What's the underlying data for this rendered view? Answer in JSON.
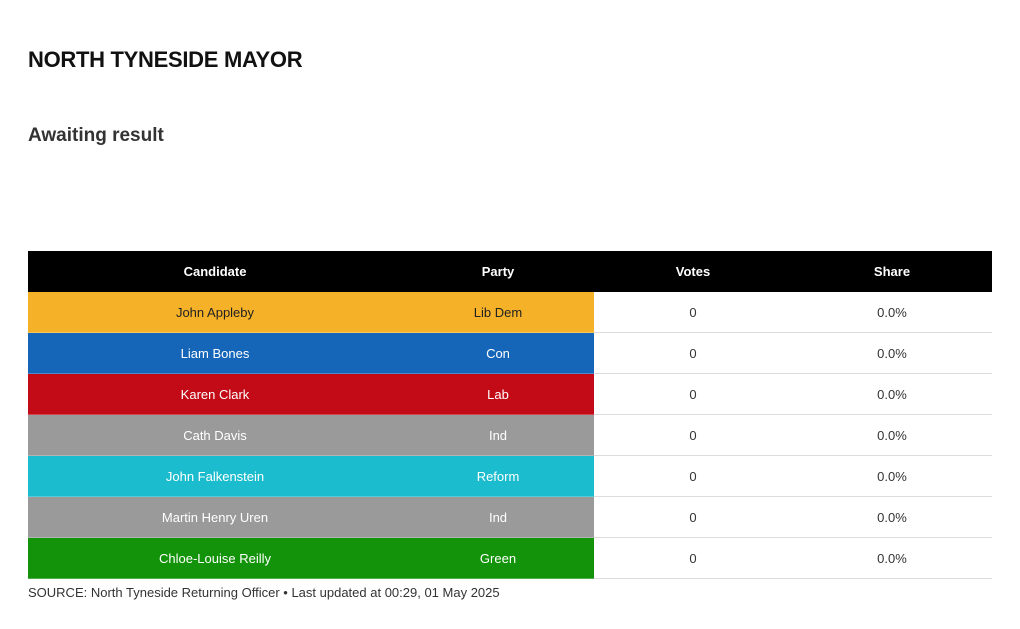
{
  "title": "NORTH TYNESIDE MAYOR",
  "status": "Awaiting result",
  "table": {
    "headers": {
      "candidate": "Candidate",
      "party": "Party",
      "votes": "Votes",
      "share": "Share"
    },
    "rows": [
      {
        "candidate": "John Appleby",
        "party": "Lib Dem",
        "votes": "0",
        "share": "0.0%",
        "color": "#f5b128",
        "text_color": "#222222"
      },
      {
        "candidate": "Liam Bones",
        "party": "Con",
        "votes": "0",
        "share": "0.0%",
        "color": "#1565b8",
        "text_color": "#ffffff"
      },
      {
        "candidate": "Karen Clark",
        "party": "Lab",
        "votes": "0",
        "share": "0.0%",
        "color": "#c30b17",
        "text_color": "#ffffff"
      },
      {
        "candidate": "Cath Davis",
        "party": "Ind",
        "votes": "0",
        "share": "0.0%",
        "color": "#9a9a9a",
        "text_color": "#ffffff"
      },
      {
        "candidate": "John Falkenstein",
        "party": "Reform",
        "votes": "0",
        "share": "0.0%",
        "color": "#1bbccd",
        "text_color": "#ffffff"
      },
      {
        "candidate": "Martin Henry Uren",
        "party": "Ind",
        "votes": "0",
        "share": "0.0%",
        "color": "#9a9a9a",
        "text_color": "#ffffff"
      },
      {
        "candidate": "Chloe-Louise Reilly",
        "party": "Green",
        "votes": "0",
        "share": "0.0%",
        "color": "#13930a",
        "text_color": "#ffffff"
      }
    ]
  },
  "source": "SOURCE: North Tyneside Returning Officer • Last updated at 00:29, 01 May 2025"
}
